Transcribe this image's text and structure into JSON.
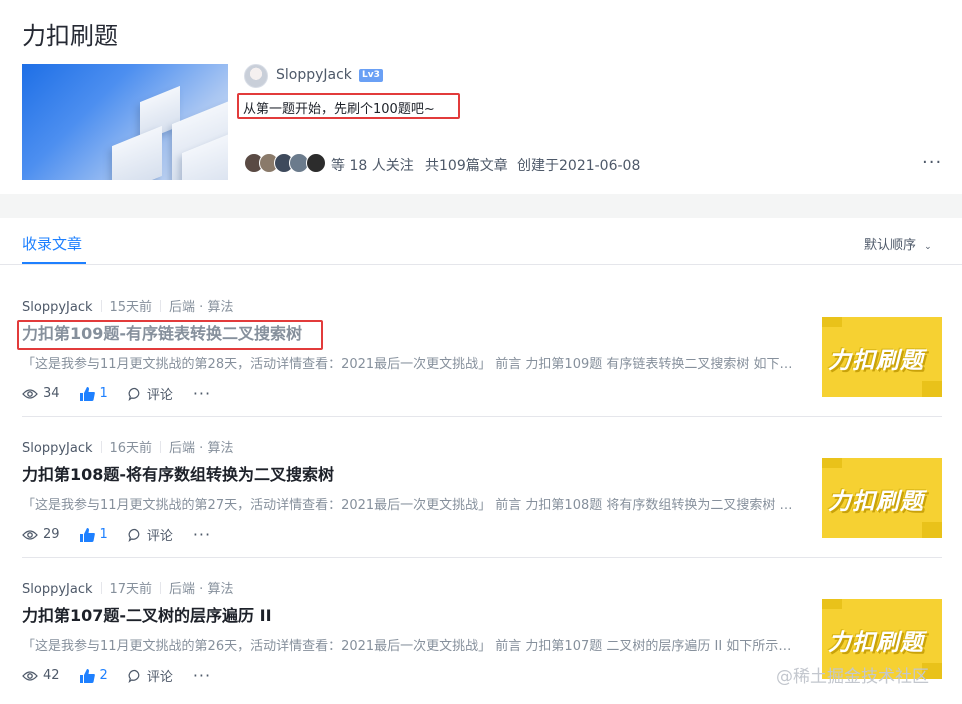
{
  "page": {
    "title": "力扣刷题"
  },
  "column": {
    "author": "SloppyJack",
    "level": "Lv3",
    "description": "从第一题开始，先刷个100题吧~",
    "followers_text": "等 18 人关注",
    "articles_count": "共109篇文章",
    "created": "创建于2021-06-08",
    "more": "···"
  },
  "tabs": {
    "active": "收录文章",
    "sort": "默认顺序"
  },
  "articles": [
    {
      "author": "SloppyJack",
      "time": "15天前",
      "tags": "后端 · 算法",
      "title": "力扣第109题-有序链表转换二叉搜索树",
      "excerpt": "「这是我参与11月更文挑战的第28天，活动详情查看：2021最后一次更文挑战」 前言 力扣第109题 有序链表转换二叉搜索树 如下所...",
      "views": "34",
      "likes": "1",
      "comments": "评论",
      "thumb_text": "力扣刷题"
    },
    {
      "author": "SloppyJack",
      "time": "16天前",
      "tags": "后端 · 算法",
      "title": "力扣第108题-将有序数组转换为二叉搜索树",
      "excerpt": "「这是我参与11月更文挑战的第27天，活动详情查看：2021最后一次更文挑战」 前言 力扣第108题 将有序数组转换为二叉搜索树 如...",
      "views": "29",
      "likes": "1",
      "comments": "评论",
      "thumb_text": "力扣刷题"
    },
    {
      "author": "SloppyJack",
      "time": "17天前",
      "tags": "后端 · 算法",
      "title": "力扣第107题-二叉树的层序遍历 II",
      "excerpt": "「这是我参与11月更文挑战的第26天，活动详情查看：2021最后一次更文挑战」 前言 力扣第107题 二叉树的层序遍历 II 如下所示：...",
      "views": "42",
      "likes": "2",
      "comments": "评论",
      "thumb_text": "力扣刷题"
    }
  ],
  "watermark": "@稀土掘金技术社区",
  "colors": {
    "accent": "#1e80ff",
    "highlight": "#e23b3b",
    "thumb": "#f6d132"
  }
}
